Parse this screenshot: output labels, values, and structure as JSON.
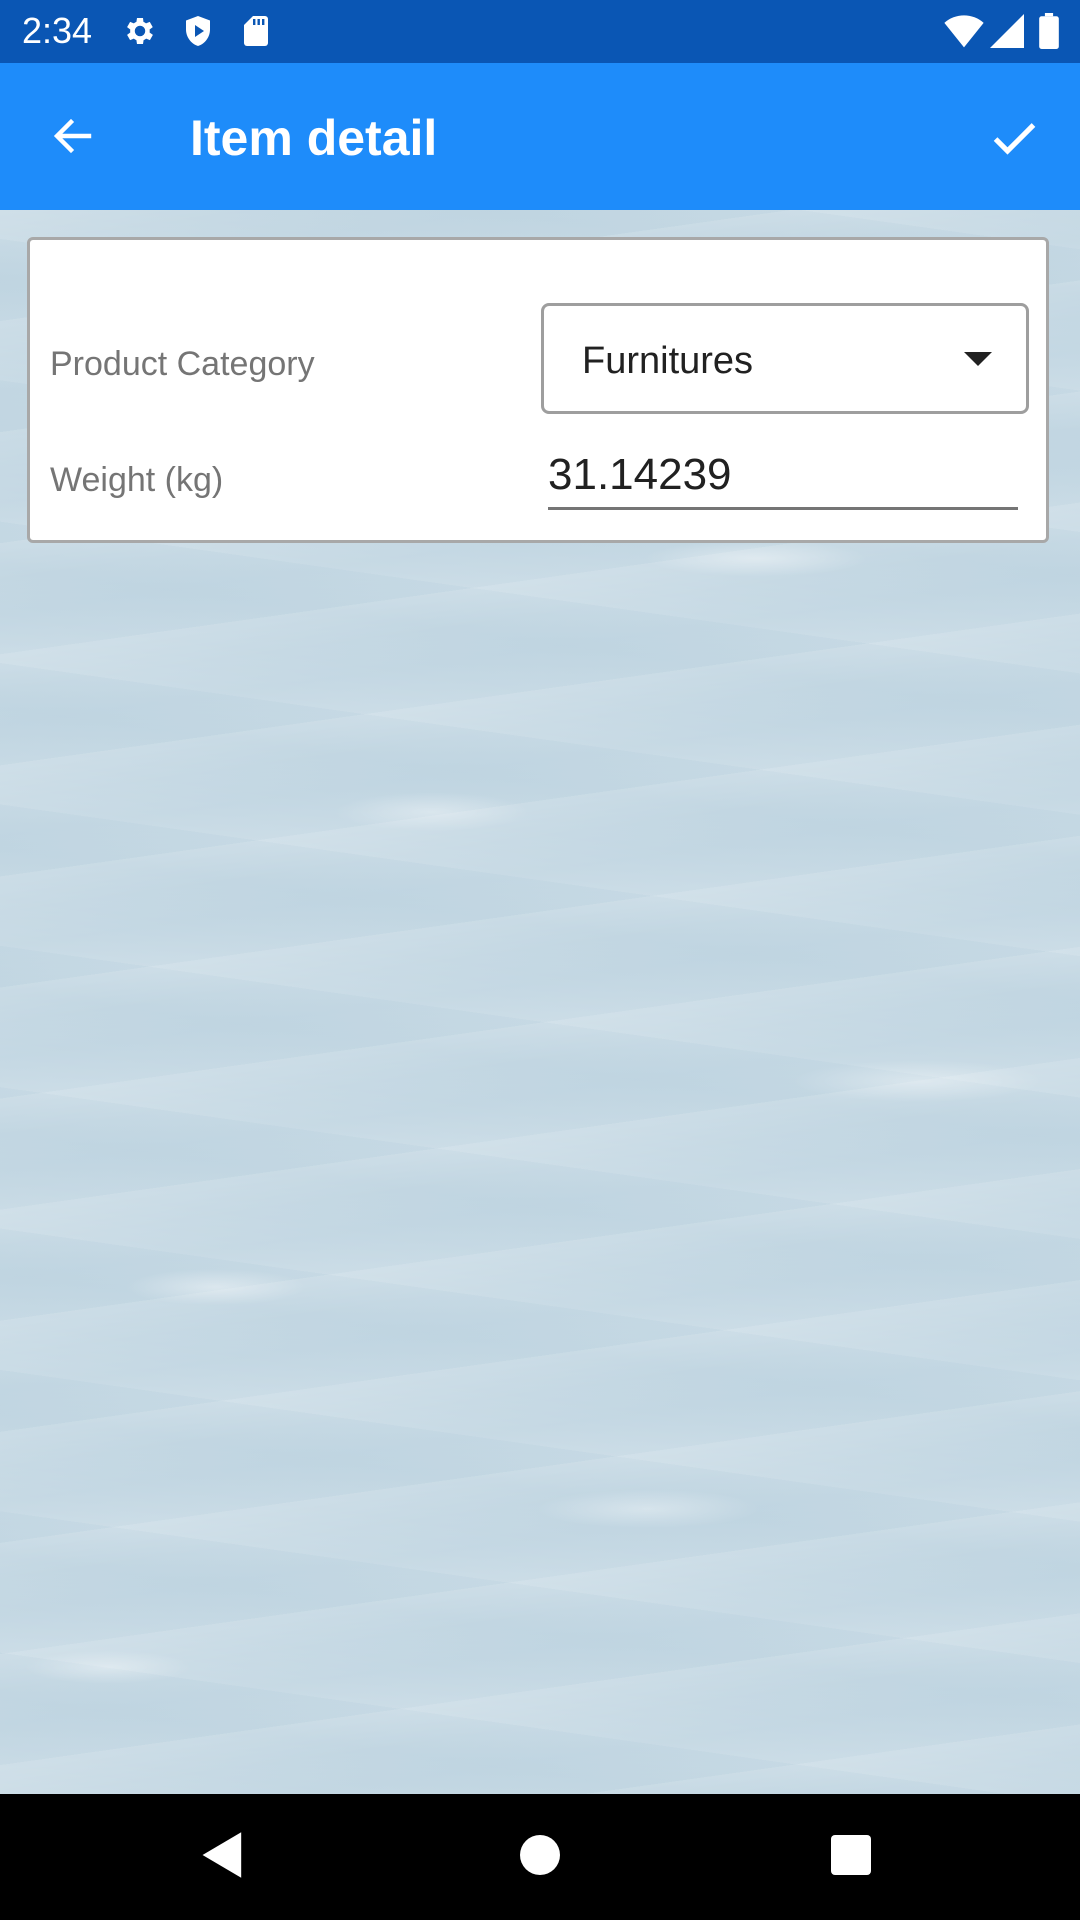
{
  "status_bar": {
    "time": "2:34",
    "left_icons": [
      "gear-icon",
      "shield-play-icon",
      "sd-card-icon"
    ],
    "right_icons": [
      "wifi-icon",
      "cell-signal-icon",
      "battery-icon"
    ]
  },
  "app_bar": {
    "title": "Item detail",
    "back_icon": "arrow-left-icon",
    "confirm_icon": "check-icon",
    "color": "#1e8cfa"
  },
  "form": {
    "category_label": "Product Category",
    "category_value": "Furnitures",
    "weight_label": "Weight (kg)",
    "weight_value": "31.14239"
  },
  "nav_bar": {
    "icons": [
      "back-triangle-icon",
      "home-circle-icon",
      "recents-square-icon"
    ]
  },
  "colors": {
    "status_bar": "#0a56b4",
    "accent": "#1e8cfa",
    "background": "#c6d9e4"
  }
}
